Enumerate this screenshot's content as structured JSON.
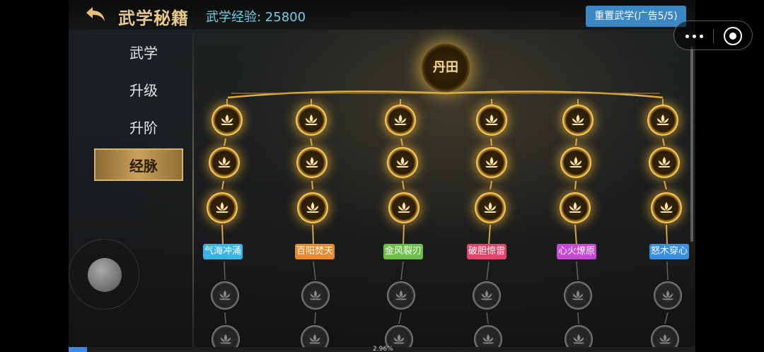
{
  "header": {
    "title": "武学秘籍",
    "exp_label": "武学经验: 25800",
    "reset_button": "重置武学(广告5/5)"
  },
  "sidebar": {
    "items": [
      {
        "label": "武学",
        "active": false
      },
      {
        "label": "升级",
        "active": false
      },
      {
        "label": "升阶",
        "active": false
      },
      {
        "label": "经脉",
        "active": true
      }
    ]
  },
  "tree": {
    "root_label": "丹田",
    "branches": [
      {
        "name": "气海冲涌",
        "color": "#3ab4e6"
      },
      {
        "name": "百阳焚天",
        "color": "#e88a2e"
      },
      {
        "name": "金风裂刃",
        "color": "#6cc04a"
      },
      {
        "name": "破胆惊雷",
        "color": "#e0456a"
      },
      {
        "name": "心火燎原",
        "color": "#c64ad6"
      },
      {
        "name": "怒木穿心",
        "color": "#3a90e0"
      }
    ]
  },
  "progress": {
    "label": "2.96%",
    "value": 2.96
  },
  "icons": [
    "back-arrow-icon",
    "lotus-icon",
    "more-dots-icon",
    "record-icon"
  ]
}
